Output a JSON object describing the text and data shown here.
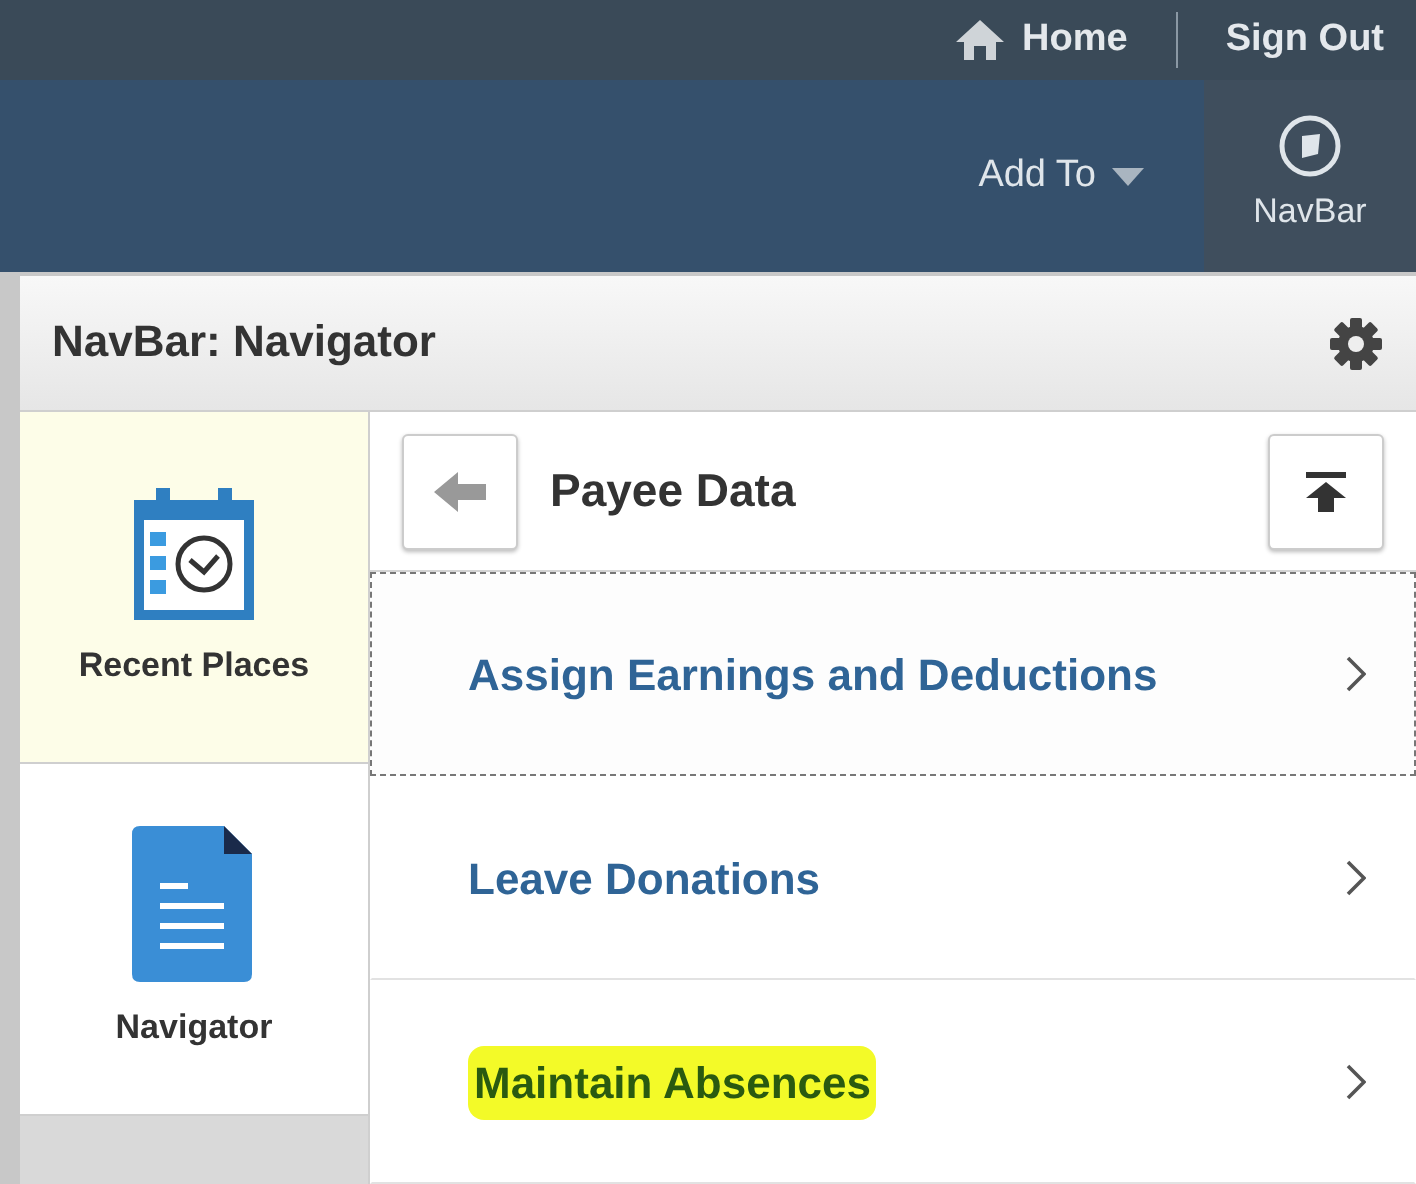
{
  "top_bar": {
    "links": [
      {
        "kind": "home",
        "label": "Home"
      },
      {
        "kind": "plain",
        "label": "Sign Out"
      }
    ]
  },
  "banner": {
    "add_to": "Add To",
    "navbar_button": "NavBar"
  },
  "panel": {
    "title": "NavBar: Navigator",
    "tiles": [
      {
        "kind": "calendar",
        "label": "Recent Places",
        "selected": true
      },
      {
        "kind": "document",
        "label": "Navigator",
        "selected": false
      }
    ],
    "folder": {
      "title": "Payee Data"
    },
    "items": [
      {
        "label": "Assign Earnings and Deductions",
        "focused": true,
        "highlighted": false
      },
      {
        "label": "Leave Donations",
        "focused": false,
        "highlighted": false
      },
      {
        "label": "Maintain Absences",
        "focused": false,
        "highlighted": true
      }
    ]
  }
}
